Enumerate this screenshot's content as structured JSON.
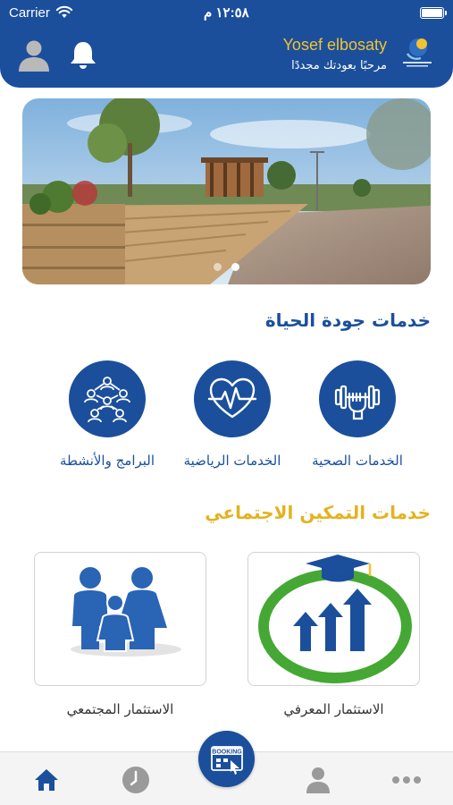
{
  "status_bar": {
    "carrier": "Carrier",
    "time": "١٢:٥٨ م",
    "wifi_icon": "wifi-icon",
    "battery_icon": "battery-icon"
  },
  "header": {
    "user_name": "Yosef elbosaty",
    "welcome_text": "مرحبًا بعودتك مجددًا",
    "avatar_icon": "user-avatar-icon",
    "bell_icon": "bell-icon",
    "logo_icon": "center-logo-icon",
    "background_color": "#1b4f9c",
    "name_color": "#f2c230"
  },
  "banner": {
    "image": "park-walkway-photo",
    "slides": 2,
    "active_slide": 2
  },
  "quality_section": {
    "title": "خدمات جودة الحياة",
    "title_color": "#1b4f9c",
    "items": [
      {
        "label": "الخدمات الصحية",
        "icon": "dumbbell-fist-icon"
      },
      {
        "label": "الخدمات الرياضية",
        "icon": "heart-pulse-icon"
      },
      {
        "label": "البرامج والأنشطة",
        "icon": "people-network-icon"
      }
    ]
  },
  "empowerment_section": {
    "title": "خدمات التمكين الاجتماعي",
    "title_color": "#e4b21e",
    "cards": [
      {
        "label": "الاستثمار المعرفي",
        "icon": "graduation-growth-icon"
      },
      {
        "label": "الاستثمار المجتمعي",
        "icon": "family-icon"
      }
    ]
  },
  "tab_bar": {
    "booking_label": "BOOKING",
    "tabs": [
      {
        "name": "home",
        "icon": "home-icon",
        "active": true
      },
      {
        "name": "history",
        "icon": "clock-icon",
        "active": false
      },
      {
        "name": "profile",
        "icon": "person-icon",
        "active": false
      },
      {
        "name": "more",
        "icon": "more-dots-icon",
        "active": false
      }
    ],
    "active_color": "#1b4f9c",
    "inactive_color": "#9a9a9a"
  }
}
